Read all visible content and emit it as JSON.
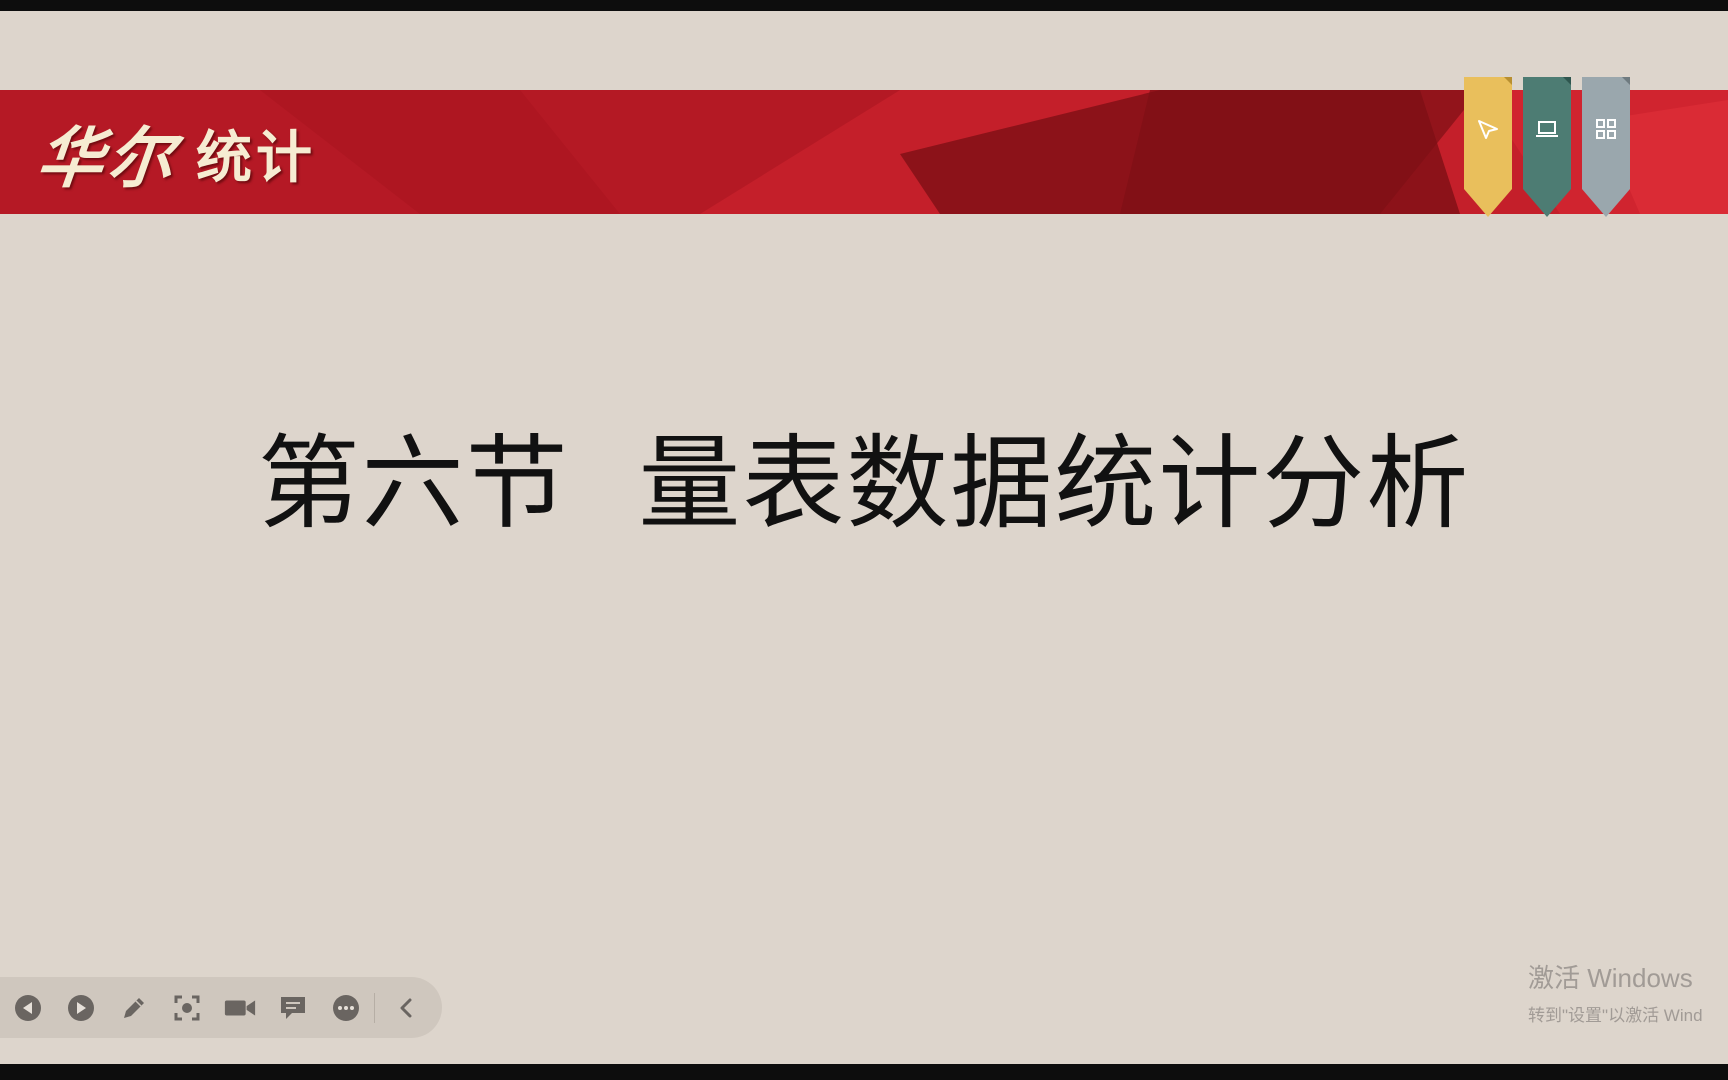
{
  "banner": {
    "brand_part1": "华尔",
    "brand_part2": "统计",
    "ribbons": [
      {
        "name": "pointer-icon",
        "color": "#e9bf5c"
      },
      {
        "name": "laptop-icon",
        "color": "#4d7c73"
      },
      {
        "name": "grid-icon",
        "color": "#9aa7ad"
      }
    ]
  },
  "slide": {
    "title": "第六节  量表数据统计分析"
  },
  "watermark": {
    "line1": "激活 Windows",
    "line2": "转到\"设置\"以激活 Wind"
  },
  "toolbar": {
    "buttons": [
      "prev-icon",
      "next-icon",
      "pen-icon",
      "screenshot-icon",
      "camera-icon",
      "comment-icon",
      "more-icon",
      "collapse-icon"
    ]
  },
  "colors": {
    "banner_red": "#c41f2a",
    "slide_bg": "#ddd5cc"
  }
}
